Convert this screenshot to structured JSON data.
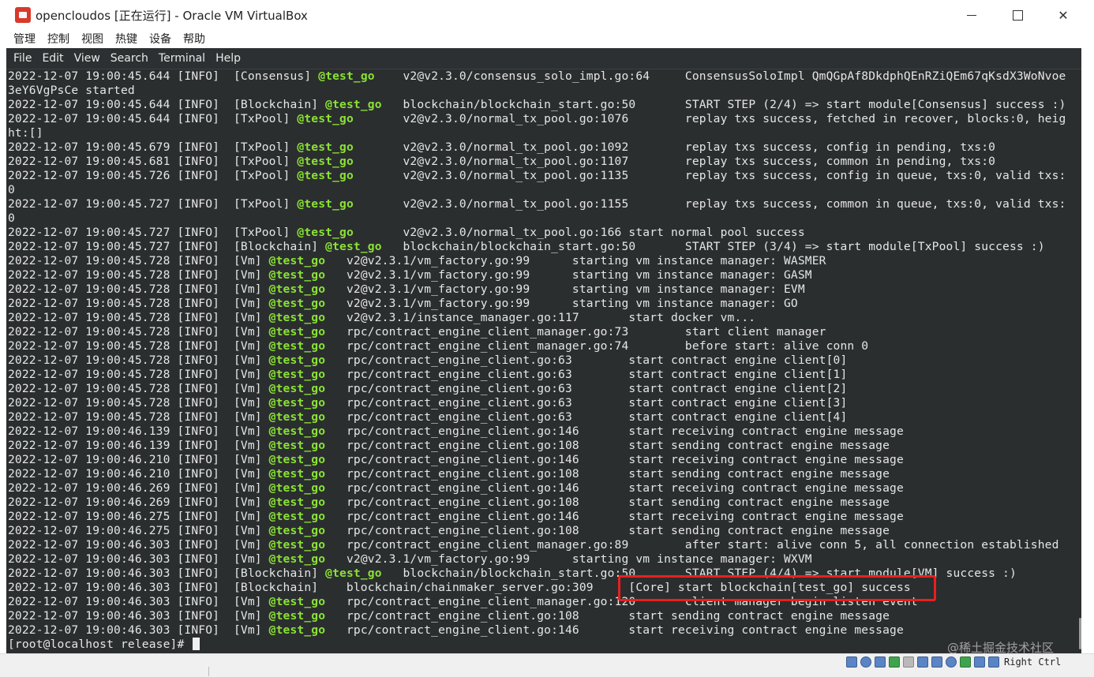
{
  "window": {
    "title": "opencloudos [正在运行] - Oracle VM VirtualBox",
    "menu": [
      "管理",
      "控制",
      "视图",
      "热键",
      "设备",
      "帮助"
    ],
    "controls": {
      "minimize": "—",
      "maximize": "□",
      "close": "✕"
    }
  },
  "terminal": {
    "menu": [
      "File",
      "Edit",
      "View",
      "Search",
      "Terminal",
      "Help"
    ],
    "lines": [
      {
        "pre": "2022-12-07 19:00:45.644 [INFO]  [Consensus] ",
        "tag": "@test_go",
        "post": "    v2@v2.3.0/consensus_solo_impl.go:64     ConsensusSoloImpl QmQGpAf8DkdphQEnRZiQEm67qKsdX3WoNvoe"
      },
      {
        "pre": "3eY6VgPsCe started",
        "tag": "",
        "post": ""
      },
      {
        "pre": "2022-12-07 19:00:45.644 [INFO]  [Blockchain] ",
        "tag": "@test_go",
        "post": "   blockchain/blockchain_start.go:50       START STEP (2/4) => start module[Consensus] success :)"
      },
      {
        "pre": "2022-12-07 19:00:45.644 [INFO]  [TxPool] ",
        "tag": "@test_go",
        "post": "       v2@v2.3.0/normal_tx_pool.go:1076        replay txs success, fetched in recover, blocks:0, heig"
      },
      {
        "pre": "ht:[]",
        "tag": "",
        "post": ""
      },
      {
        "pre": "2022-12-07 19:00:45.679 [INFO]  [TxPool] ",
        "tag": "@test_go",
        "post": "       v2@v2.3.0/normal_tx_pool.go:1092        replay txs success, config in pending, txs:0"
      },
      {
        "pre": "2022-12-07 19:00:45.681 [INFO]  [TxPool] ",
        "tag": "@test_go",
        "post": "       v2@v2.3.0/normal_tx_pool.go:1107        replay txs success, common in pending, txs:0"
      },
      {
        "pre": "2022-12-07 19:00:45.726 [INFO]  [TxPool] ",
        "tag": "@test_go",
        "post": "       v2@v2.3.0/normal_tx_pool.go:1135        replay txs success, config in queue, txs:0, valid txs:"
      },
      {
        "pre": "0",
        "tag": "",
        "post": ""
      },
      {
        "pre": "2022-12-07 19:00:45.727 [INFO]  [TxPool] ",
        "tag": "@test_go",
        "post": "       v2@v2.3.0/normal_tx_pool.go:1155        replay txs success, common in queue, txs:0, valid txs:"
      },
      {
        "pre": "0",
        "tag": "",
        "post": ""
      },
      {
        "pre": "2022-12-07 19:00:45.727 [INFO]  [TxPool] ",
        "tag": "@test_go",
        "post": "       v2@v2.3.0/normal_tx_pool.go:166 start normal pool success"
      },
      {
        "pre": "2022-12-07 19:00:45.727 [INFO]  [Blockchain] ",
        "tag": "@test_go",
        "post": "   blockchain/blockchain_start.go:50       START STEP (3/4) => start module[TxPool] success :)"
      },
      {
        "pre": "2022-12-07 19:00:45.728 [INFO]  [Vm] ",
        "tag": "@test_go",
        "post": "   v2@v2.3.1/vm_factory.go:99      starting vm instance manager: WASMER"
      },
      {
        "pre": "2022-12-07 19:00:45.728 [INFO]  [Vm] ",
        "tag": "@test_go",
        "post": "   v2@v2.3.1/vm_factory.go:99      starting vm instance manager: GASM"
      },
      {
        "pre": "2022-12-07 19:00:45.728 [INFO]  [Vm] ",
        "tag": "@test_go",
        "post": "   v2@v2.3.1/vm_factory.go:99      starting vm instance manager: EVM"
      },
      {
        "pre": "2022-12-07 19:00:45.728 [INFO]  [Vm] ",
        "tag": "@test_go",
        "post": "   v2@v2.3.1/vm_factory.go:99      starting vm instance manager: GO"
      },
      {
        "pre": "2022-12-07 19:00:45.728 [INFO]  [Vm] ",
        "tag": "@test_go",
        "post": "   v2@v2.3.1/instance_manager.go:117       start docker vm..."
      },
      {
        "pre": "2022-12-07 19:00:45.728 [INFO]  [Vm] ",
        "tag": "@test_go",
        "post": "   rpc/contract_engine_client_manager.go:73        start client manager"
      },
      {
        "pre": "2022-12-07 19:00:45.728 [INFO]  [Vm] ",
        "tag": "@test_go",
        "post": "   rpc/contract_engine_client_manager.go:74        before start: alive conn 0"
      },
      {
        "pre": "2022-12-07 19:00:45.728 [INFO]  [Vm] ",
        "tag": "@test_go",
        "post": "   rpc/contract_engine_client.go:63        start contract engine client[0]"
      },
      {
        "pre": "2022-12-07 19:00:45.728 [INFO]  [Vm] ",
        "tag": "@test_go",
        "post": "   rpc/contract_engine_client.go:63        start contract engine client[1]"
      },
      {
        "pre": "2022-12-07 19:00:45.728 [INFO]  [Vm] ",
        "tag": "@test_go",
        "post": "   rpc/contract_engine_client.go:63        start contract engine client[2]"
      },
      {
        "pre": "2022-12-07 19:00:45.728 [INFO]  [Vm] ",
        "tag": "@test_go",
        "post": "   rpc/contract_engine_client.go:63        start contract engine client[3]"
      },
      {
        "pre": "2022-12-07 19:00:45.728 [INFO]  [Vm] ",
        "tag": "@test_go",
        "post": "   rpc/contract_engine_client.go:63        start contract engine client[4]"
      },
      {
        "pre": "2022-12-07 19:00:46.139 [INFO]  [Vm] ",
        "tag": "@test_go",
        "post": "   rpc/contract_engine_client.go:146       start receiving contract engine message"
      },
      {
        "pre": "2022-12-07 19:00:46.139 [INFO]  [Vm] ",
        "tag": "@test_go",
        "post": "   rpc/contract_engine_client.go:108       start sending contract engine message"
      },
      {
        "pre": "2022-12-07 19:00:46.210 [INFO]  [Vm] ",
        "tag": "@test_go",
        "post": "   rpc/contract_engine_client.go:146       start receiving contract engine message"
      },
      {
        "pre": "2022-12-07 19:00:46.210 [INFO]  [Vm] ",
        "tag": "@test_go",
        "post": "   rpc/contract_engine_client.go:108       start sending contract engine message"
      },
      {
        "pre": "2022-12-07 19:00:46.269 [INFO]  [Vm] ",
        "tag": "@test_go",
        "post": "   rpc/contract_engine_client.go:146       start receiving contract engine message"
      },
      {
        "pre": "2022-12-07 19:00:46.269 [INFO]  [Vm] ",
        "tag": "@test_go",
        "post": "   rpc/contract_engine_client.go:108       start sending contract engine message"
      },
      {
        "pre": "2022-12-07 19:00:46.275 [INFO]  [Vm] ",
        "tag": "@test_go",
        "post": "   rpc/contract_engine_client.go:146       start receiving contract engine message"
      },
      {
        "pre": "2022-12-07 19:00:46.275 [INFO]  [Vm] ",
        "tag": "@test_go",
        "post": "   rpc/contract_engine_client.go:108       start sending contract engine message"
      },
      {
        "pre": "2022-12-07 19:00:46.303 [INFO]  [Vm] ",
        "tag": "@test_go",
        "post": "   rpc/contract_engine_client_manager.go:89        after start: alive conn 5, all connection established"
      },
      {
        "pre": "2022-12-07 19:00:46.303 [INFO]  [Vm] ",
        "tag": "@test_go",
        "post": "   v2@v2.3.1/vm_factory.go:99      starting vm instance manager: WXVM"
      },
      {
        "pre": "2022-12-07 19:00:46.303 [INFO]  [Blockchain] ",
        "tag": "@test_go",
        "post": "   blockchain/blockchain_start.go:50       START STEP (4/4) => start module[VM] success :)"
      },
      {
        "pre": "2022-12-07 19:00:46.303 [INFO]  [Blockchain]    blockchain/chainmaker_server.go:309     [Core] start blockchain[test_go] success",
        "tag": "",
        "post": ""
      },
      {
        "pre": "2022-12-07 19:00:46.303 [INFO]  [Vm] ",
        "tag": "@test_go",
        "post": "   rpc/contract_engine_client_manager.go:120       client manager begin listen event"
      },
      {
        "pre": "2022-12-07 19:00:46.303 [INFO]  [Vm] ",
        "tag": "@test_go",
        "post": "   rpc/contract_engine_client.go:108       start sending contract engine message"
      },
      {
        "pre": "2022-12-07 19:00:46.303 [INFO]  [Vm] ",
        "tag": "@test_go",
        "post": "   rpc/contract_engine_client.go:146       start receiving contract engine message"
      }
    ],
    "prompt": "[root@localhost release]# "
  },
  "statusbar": {
    "host_key": "Right Ctrl",
    "icons": [
      "hard-disk-icon",
      "optical-drive-icon",
      "audio-icon",
      "network-icon",
      "usb-icon",
      "shared-folder-icon",
      "display-icon",
      "video-capture-icon",
      "cpu-icon",
      "mouse-integration-icon",
      "keyboard-capture-icon"
    ]
  },
  "watermark": "@稀土掘金技术社区",
  "colors": {
    "terminal_bg": "#2b2e2f",
    "tag_green": "#8ae234",
    "highlight_red": "#e8201f"
  }
}
